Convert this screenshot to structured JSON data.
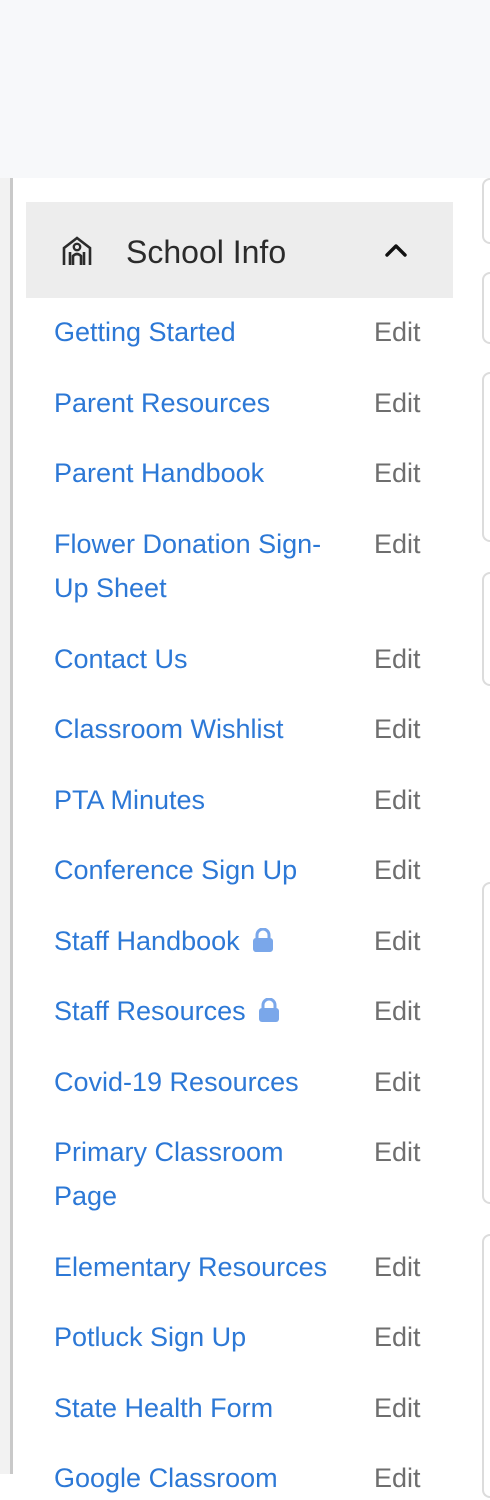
{
  "sidebar": {
    "section": {
      "title": "School Info",
      "icon": "school-icon",
      "expanded": true
    },
    "edit_label": "Edit",
    "items": [
      {
        "label": "Getting Started",
        "locked": false
      },
      {
        "label": "Parent Resources",
        "locked": false
      },
      {
        "label": "Parent Handbook",
        "locked": false
      },
      {
        "label": "Flower Donation Sign-Up Sheet",
        "locked": false
      },
      {
        "label": "Contact Us",
        "locked": false
      },
      {
        "label": "Classroom Wishlist",
        "locked": false
      },
      {
        "label": "PTA Minutes",
        "locked": false
      },
      {
        "label": "Conference Sign Up",
        "locked": false
      },
      {
        "label": "Staff Handbook",
        "locked": true
      },
      {
        "label": "Staff Resources",
        "locked": true
      },
      {
        "label": "Covid-19 Resources",
        "locked": false
      },
      {
        "label": "Primary Classroom Page",
        "locked": false
      },
      {
        "label": "Elementary Resources",
        "locked": false
      },
      {
        "label": "Potluck Sign Up",
        "locked": false
      },
      {
        "label": "State Health Form",
        "locked": false
      },
      {
        "label": "Google Classroom",
        "locked": false
      }
    ]
  },
  "colors": {
    "link": "#2c78d6",
    "edit": "#6e6e6e",
    "header_bg": "#ededed",
    "lock": "#7aa7ea"
  }
}
